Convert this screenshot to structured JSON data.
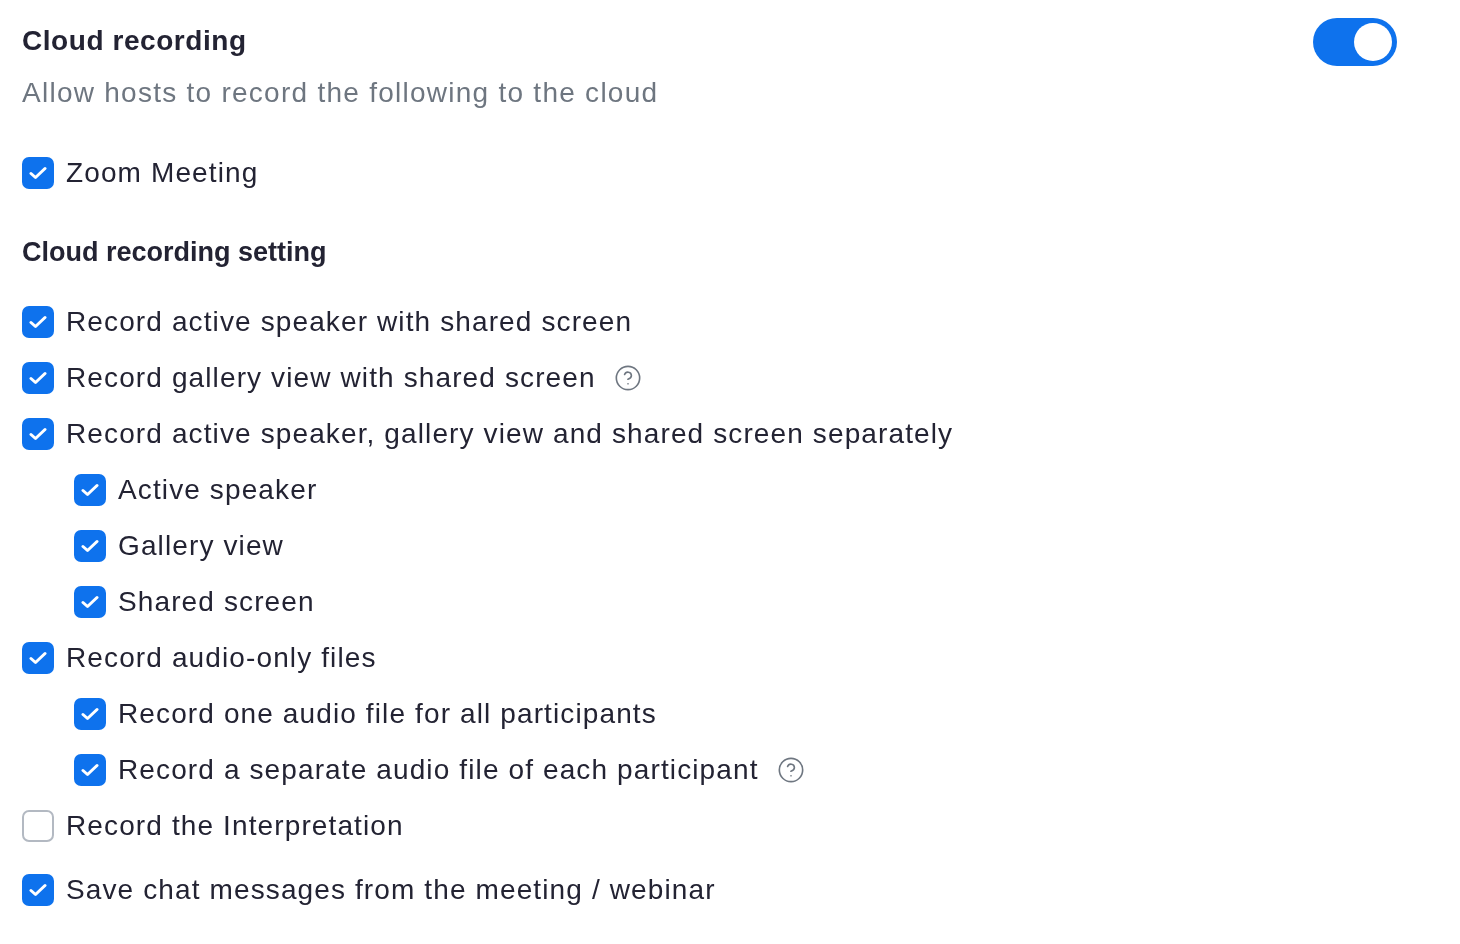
{
  "header": {
    "title": "Cloud recording",
    "subtitle": "Allow hosts to record the following to the cloud",
    "toggle": {
      "on": true
    }
  },
  "meeting_types": [
    {
      "label": "Zoom Meeting",
      "checked": true
    }
  ],
  "section": {
    "title": "Cloud recording setting"
  },
  "settings": [
    {
      "label": "Record active speaker with shared screen",
      "checked": true,
      "help_icon": false
    },
    {
      "label": "Record gallery view with shared screen",
      "checked": true,
      "help_icon": true
    },
    {
      "label": "Record active speaker, gallery view and shared screen separately",
      "checked": true,
      "help_icon": false,
      "children": [
        {
          "label": "Active speaker",
          "checked": true,
          "help_icon": false
        },
        {
          "label": "Gallery view",
          "checked": true,
          "help_icon": false
        },
        {
          "label": "Shared screen",
          "checked": true,
          "help_icon": false
        }
      ]
    },
    {
      "label": "Record audio-only files",
      "checked": true,
      "help_icon": false,
      "children": [
        {
          "label": "Record one audio file for all participants",
          "checked": true,
          "help_icon": false
        },
        {
          "label": "Record a separate audio file of each participant",
          "checked": true,
          "help_icon": true
        }
      ]
    },
    {
      "label": "Record the Interpretation",
      "checked": false,
      "help_icon": false
    },
    {
      "label": "Save chat messages from the meeting / webinar",
      "checked": true,
      "help_icon": false
    }
  ]
}
